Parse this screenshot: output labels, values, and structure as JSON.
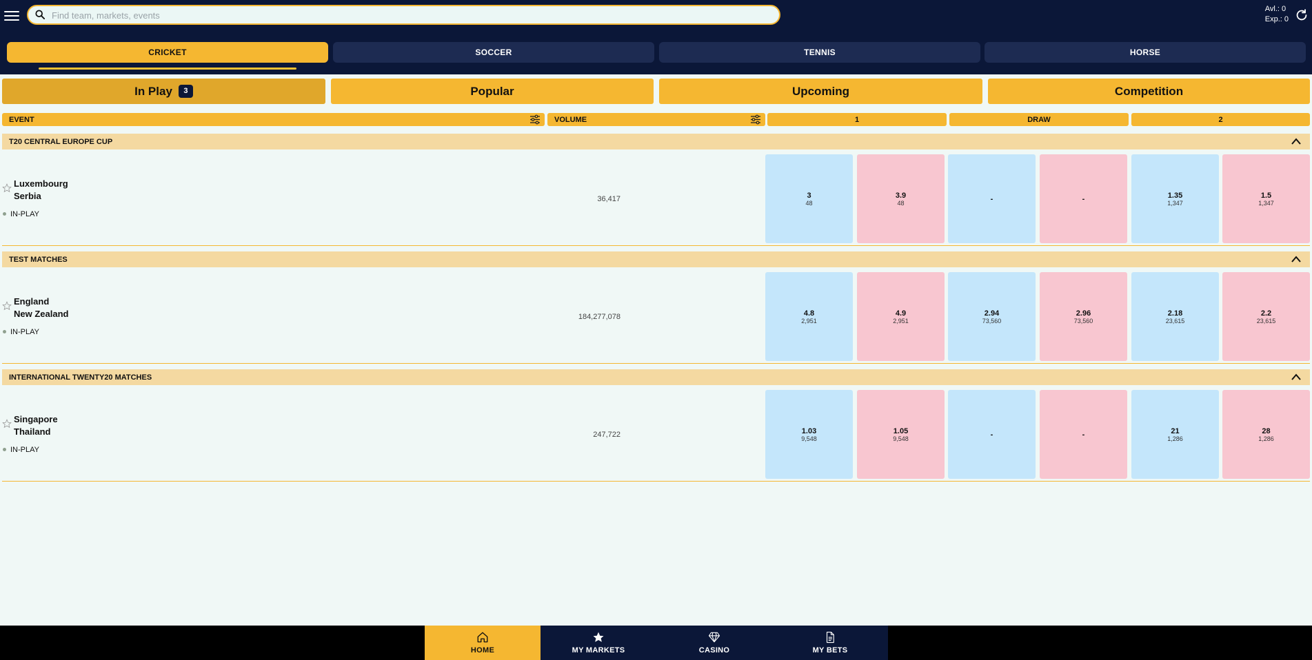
{
  "header": {
    "search_placeholder": "Find team, markets, events",
    "available": "Avl.: 0",
    "exposure": "Exp.: 0"
  },
  "sports_tabs": [
    {
      "label": "CRICKET",
      "active": true
    },
    {
      "label": "SOCCER",
      "active": false
    },
    {
      "label": "TENNIS",
      "active": false
    },
    {
      "label": "HORSE",
      "active": false
    }
  ],
  "filter_tabs": [
    {
      "label": "In Play",
      "count": "3",
      "active": true
    },
    {
      "label": "Popular",
      "active": false
    },
    {
      "label": "Upcoming",
      "active": false
    },
    {
      "label": "Competition",
      "active": false
    }
  ],
  "columns": {
    "event": "EVENT",
    "volume": "VOLUME",
    "col1": "1",
    "draw": "DRAW",
    "col2": "2"
  },
  "competitions": [
    {
      "name": "T20 CENTRAL EUROPE CUP",
      "event": {
        "team1": "Luxembourg",
        "team2": "Serbia",
        "status": "IN-PLAY",
        "volume": "36,417",
        "odds": [
          {
            "price": "3",
            "size": "48"
          },
          {
            "price": "3.9",
            "size": "48"
          },
          {
            "price": "-",
            "size": ""
          },
          {
            "price": "-",
            "size": ""
          },
          {
            "price": "1.35",
            "size": "1,347"
          },
          {
            "price": "1.5",
            "size": "1,347"
          }
        ]
      }
    },
    {
      "name": "TEST MATCHES",
      "event": {
        "team1": "England",
        "team2": "New Zealand",
        "status": "IN-PLAY",
        "volume": "184,277,078",
        "odds": [
          {
            "price": "4.8",
            "size": "2,951"
          },
          {
            "price": "4.9",
            "size": "2,951"
          },
          {
            "price": "2.94",
            "size": "73,560"
          },
          {
            "price": "2.96",
            "size": "73,560"
          },
          {
            "price": "2.18",
            "size": "23,615"
          },
          {
            "price": "2.2",
            "size": "23,615"
          }
        ]
      }
    },
    {
      "name": "INTERNATIONAL TWENTY20 MATCHES",
      "event": {
        "team1": "Singapore",
        "team2": "Thailand",
        "status": "IN-PLAY",
        "volume": "247,722",
        "odds": [
          {
            "price": "1.03",
            "size": "9,548"
          },
          {
            "price": "1.05",
            "size": "9,548"
          },
          {
            "price": "-",
            "size": ""
          },
          {
            "price": "-",
            "size": ""
          },
          {
            "price": "21",
            "size": "1,286"
          },
          {
            "price": "28",
            "size": "1,286"
          }
        ]
      }
    }
  ],
  "bottom_nav": [
    {
      "label": "HOME",
      "icon": "home-icon",
      "active": true
    },
    {
      "label": "MY MARKETS",
      "icon": "star-icon",
      "active": false
    },
    {
      "label": "CASINO",
      "icon": "diamond-icon",
      "active": false
    },
    {
      "label": "MY BETS",
      "icon": "document-icon",
      "active": false
    }
  ],
  "colors": {
    "navy": "#0b1738",
    "accent": "#f5b731",
    "back": "#c4e6fb",
    "lay": "#f8c6d0",
    "competition_header": "#f4d9a1"
  }
}
